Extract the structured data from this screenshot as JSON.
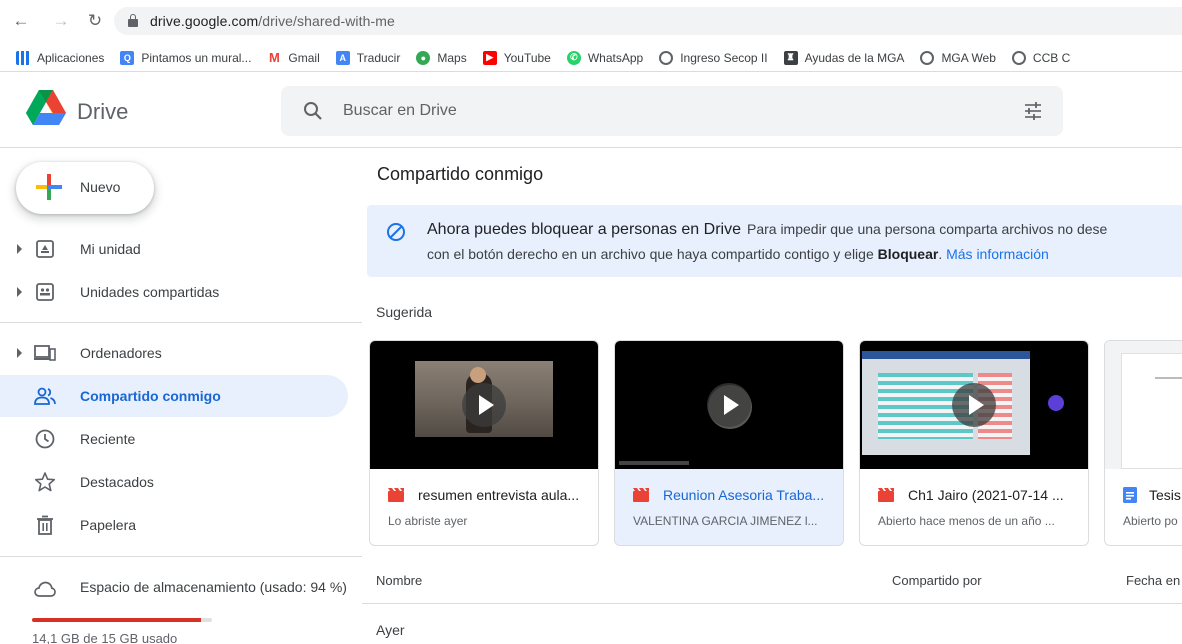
{
  "browser": {
    "url_host": "drive.google.com",
    "url_path": "/drive/shared-with-me",
    "bookmarks": [
      {
        "label": "Aplicaciones",
        "icon": "apps-grid-icon",
        "color": "#1a73e8"
      },
      {
        "label": "Pintamos un mural...",
        "icon": "qualtrics-icon",
        "color": "#4285f4"
      },
      {
        "label": "Gmail",
        "icon": "gmail-icon",
        "color": "#ea4335"
      },
      {
        "label": "Traducir",
        "icon": "translate-icon",
        "color": "#4285f4"
      },
      {
        "label": "Maps",
        "icon": "maps-pin-icon",
        "color": "#34a853"
      },
      {
        "label": "YouTube",
        "icon": "youtube-icon",
        "color": "#ff0000"
      },
      {
        "label": "WhatsApp",
        "icon": "whatsapp-icon",
        "color": "#25d366"
      },
      {
        "label": "Ingreso Secop II",
        "icon": "globe-icon",
        "color": "#5f6368"
      },
      {
        "label": "Ayudas de la MGA",
        "icon": "shield-crest-icon",
        "color": "#3c4043"
      },
      {
        "label": "MGA Web",
        "icon": "globe-icon",
        "color": "#5f6368"
      },
      {
        "label": "CCB C",
        "icon": "globe-icon",
        "color": "#5f6368"
      }
    ]
  },
  "header": {
    "app_name": "Drive",
    "search_placeholder": "Buscar en Drive"
  },
  "sidebar": {
    "new_label": "Nuevo",
    "items": [
      {
        "label": "Mi unidad",
        "icon": "my-drive-icon"
      },
      {
        "label": "Unidades compartidas",
        "icon": "shared-drives-icon"
      },
      {
        "label": "Ordenadores",
        "icon": "computers-icon"
      },
      {
        "label": "Compartido conmigo",
        "icon": "people-icon"
      },
      {
        "label": "Reciente",
        "icon": "clock-icon"
      },
      {
        "label": "Destacados",
        "icon": "star-icon"
      },
      {
        "label": "Papelera",
        "icon": "trash-icon"
      }
    ],
    "storage": {
      "label": "Espacio de almacenamiento (usado: 94 %)",
      "used_fraction": 0.94,
      "text": "14,1 GB de 15 GB usado"
    }
  },
  "main": {
    "title": "Compartido conmigo",
    "banner": {
      "heading": "Ahora puedes bloquear a personas en Drive",
      "line1_rest": "Para impedir que una persona comparta archivos no dese",
      "line2_start": "con el botón derecho en un archivo que haya compartido contigo y elige",
      "line2_bold": "Bloquear",
      "line2_link": "Más información"
    },
    "suggested_label": "Sugerida",
    "cards": [
      {
        "title": "resumen entrevista aula...",
        "subtitle": "Lo abriste ayer",
        "type": "video"
      },
      {
        "title": "Reunion Asesoria Traba...",
        "subtitle": "VALENTINA GARCIA JIMENEZ l...",
        "type": "video"
      },
      {
        "title": "Ch1 Jairo (2021-07-14 ...",
        "subtitle": "Abierto hace menos de un año ...",
        "type": "video"
      },
      {
        "title": "Tesis",
        "subtitle": "Abierto po",
        "type": "doc"
      }
    ],
    "columns": {
      "name": "Nombre",
      "shared_by": "Compartido por",
      "date": "Fecha en"
    },
    "group_label": "Ayer"
  },
  "colors": {
    "accent": "#1a73e8",
    "active_bg": "#e8f0fe",
    "storage_warning": "#d93025",
    "video_red": "#ea4335",
    "doc_blue": "#4285f4"
  }
}
